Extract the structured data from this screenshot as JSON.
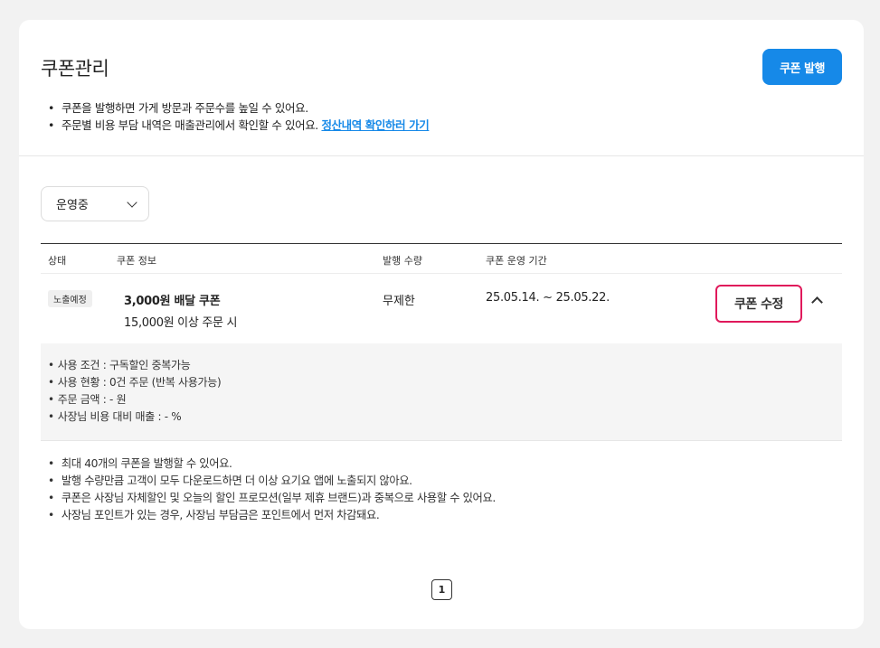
{
  "header": {
    "title": "쿠폰관리",
    "issue_button": "쿠폰 발행"
  },
  "notice": {
    "line1": "쿠폰을 발행하면 가게 방문과 주문수를 높일 수 있어요.",
    "line2": "주문별 비용 부담 내역은 매출관리에서 확인할 수 있어요.",
    "link": "정산내역 확인하러 가기"
  },
  "filter": {
    "selected": "운영중"
  },
  "table": {
    "headers": {
      "status": "상태",
      "info": "쿠폰 정보",
      "quantity": "발행 수량",
      "period": "쿠폰 운영 기간"
    },
    "row": {
      "status": "노출예정",
      "title": "3,000원 배달 쿠폰",
      "condition": "15,000원 이상 주문 시",
      "quantity": "무제한",
      "period": "25.05.14. ~ 25.05.22.",
      "edit_button": "쿠폰 수정"
    },
    "details": [
      "사용 조건 : 구독할인 중복가능",
      "사용 현황 : 0건 주문 (반복 사용가능)",
      "주문 금액 : - 원",
      "사장님 비용 대비 매출 : - %"
    ]
  },
  "footnotes": [
    "최대 40개의 쿠폰을 발행할 수 있어요.",
    "발행 수량만큼 고객이 모두 다운로드하면 더 이상 요기요 앱에 노출되지 않아요.",
    "쿠폰은 사장님 자체할인 및 오늘의 할인 프로모션(일부 제휴 브랜드)과 중복으로 사용할 수 있어요.",
    "사장님 포인트가 있는 경우, 사장님 부담금은 포인트에서 먼저 차감돼요."
  ],
  "pagination": {
    "current": "1"
  },
  "colors": {
    "primary": "#1689e8",
    "highlight": "#e0195b"
  }
}
